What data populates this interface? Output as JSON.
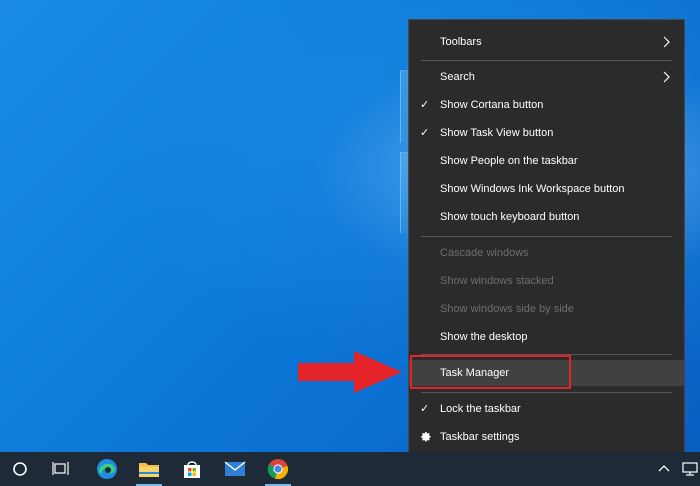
{
  "context_menu": {
    "items": [
      {
        "label": "Toolbars",
        "checked": false,
        "submenu": true,
        "enabled": true
      },
      {
        "label": "Search",
        "checked": false,
        "submenu": true,
        "enabled": true
      },
      {
        "label": "Show Cortana button",
        "checked": true,
        "submenu": false,
        "enabled": true
      },
      {
        "label": "Show Task View button",
        "checked": true,
        "submenu": false,
        "enabled": true
      },
      {
        "label": "Show People on the taskbar",
        "checked": false,
        "submenu": false,
        "enabled": true
      },
      {
        "label": "Show Windows Ink Workspace button",
        "checked": false,
        "submenu": false,
        "enabled": true
      },
      {
        "label": "Show touch keyboard button",
        "checked": false,
        "submenu": false,
        "enabled": true
      },
      {
        "label": "Cascade windows",
        "checked": false,
        "submenu": false,
        "enabled": false
      },
      {
        "label": "Show windows stacked",
        "checked": false,
        "submenu": false,
        "enabled": false
      },
      {
        "label": "Show windows side by side",
        "checked": false,
        "submenu": false,
        "enabled": false
      },
      {
        "label": "Show the desktop",
        "checked": false,
        "submenu": false,
        "enabled": true
      },
      {
        "label": "Task Manager",
        "checked": false,
        "submenu": false,
        "enabled": true,
        "highlighted": true
      },
      {
        "label": "Lock the taskbar",
        "checked": true,
        "submenu": false,
        "enabled": true
      },
      {
        "label": "Taskbar settings",
        "checked": false,
        "submenu": false,
        "enabled": true,
        "icon": "gear-icon"
      }
    ],
    "check_glyph": "✓"
  },
  "taskbar": {
    "icons": [
      "cortana-icon",
      "task-view-icon",
      "edge-icon",
      "file-explorer-icon",
      "store-icon",
      "mail-icon",
      "chrome-icon"
    ],
    "tray": [
      "tray-chevron-up-icon",
      "network-icon"
    ]
  },
  "colors": {
    "menu_bg": "#2b2b2b",
    "highlight_border": "#e5242a",
    "arrow": "#e5242a",
    "taskbar_bg": "#1e2a38"
  }
}
